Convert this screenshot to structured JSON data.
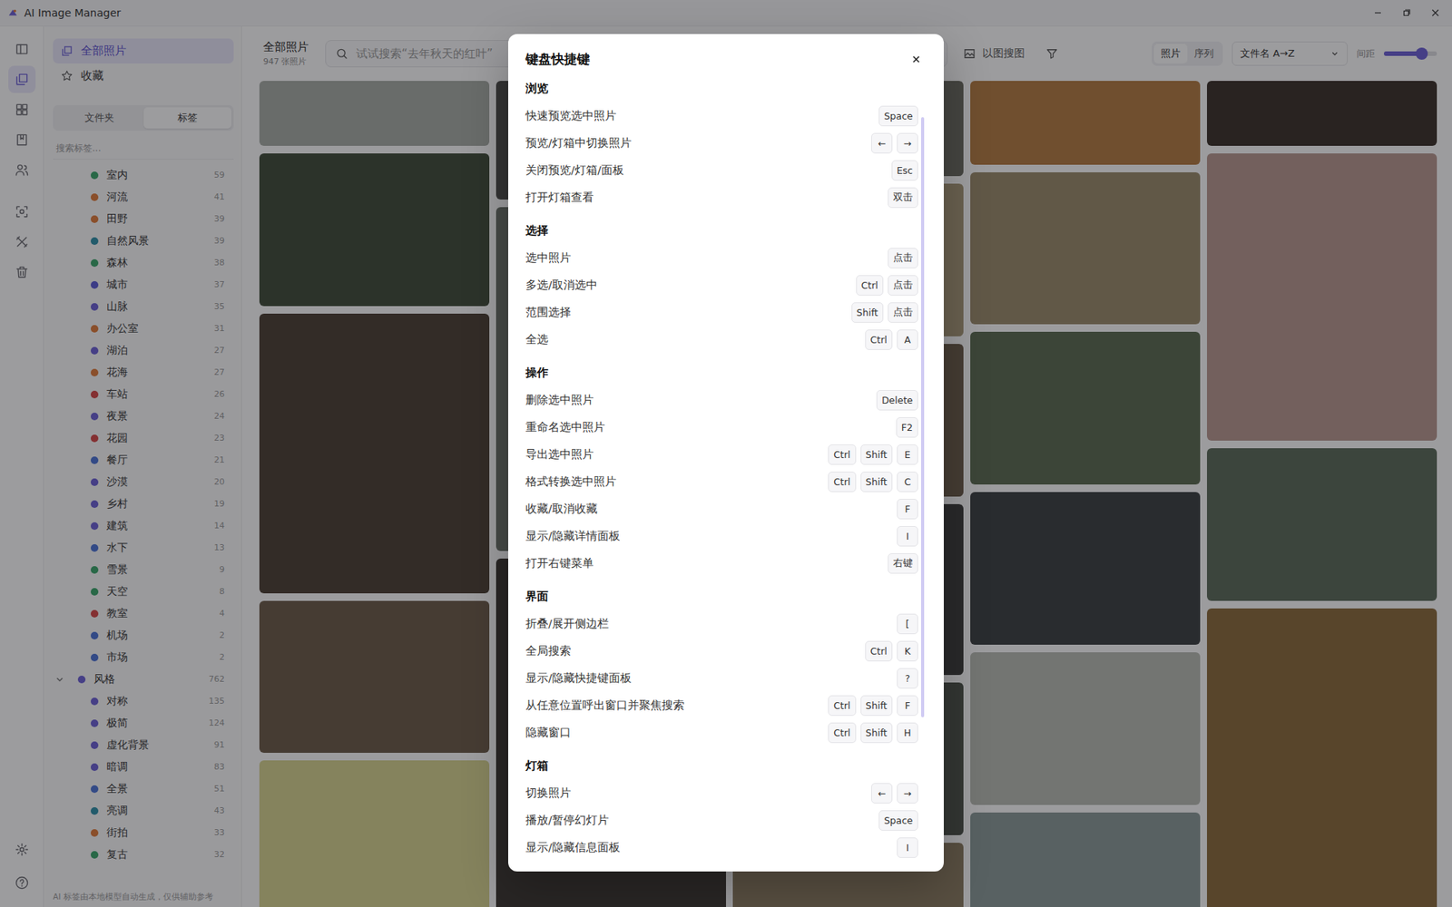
{
  "window": {
    "title": "AI Image Manager"
  },
  "rail": [
    {
      "selected": false
    },
    {
      "selected": true
    },
    {
      "selected": false
    },
    {
      "selected": false
    },
    {
      "selected": false
    },
    {
      "selected": false
    },
    {
      "selected": false
    },
    {
      "selected": false
    }
  ],
  "sidebar": {
    "nav": [
      {
        "label": "全部照片",
        "selected": true
      },
      {
        "label": "收藏",
        "selected": false
      }
    ],
    "tabs": [
      {
        "label": "文件夹",
        "selected": false
      },
      {
        "label": "标签",
        "selected": true
      }
    ],
    "search": {
      "placeholder": "搜索标签..."
    },
    "tags": [
      {
        "kind": "item",
        "name": "室内",
        "count": "59",
        "color": "#3aa66a"
      },
      {
        "kind": "item",
        "name": "河流",
        "count": "41",
        "color": "#e07b39"
      },
      {
        "kind": "item",
        "name": "田野",
        "count": "39",
        "color": "#e07b39"
      },
      {
        "kind": "item",
        "name": "自然风景",
        "count": "39",
        "color": "#2e8fa8"
      },
      {
        "kind": "item",
        "name": "森林",
        "count": "38",
        "color": "#3aa66a"
      },
      {
        "kind": "item",
        "name": "城市",
        "count": "37",
        "color": "#5b5bd6"
      },
      {
        "kind": "item",
        "name": "山脉",
        "count": "35",
        "color": "#6b5fd6"
      },
      {
        "kind": "item",
        "name": "办公室",
        "count": "31",
        "color": "#e07b39"
      },
      {
        "kind": "item",
        "name": "湖泊",
        "count": "27",
        "color": "#6b5fd6"
      },
      {
        "kind": "item",
        "name": "花海",
        "count": "27",
        "color": "#e07b39"
      },
      {
        "kind": "item",
        "name": "车站",
        "count": "26",
        "color": "#d64545"
      },
      {
        "kind": "item",
        "name": "夜景",
        "count": "24",
        "color": "#6b5fd6"
      },
      {
        "kind": "item",
        "name": "花园",
        "count": "23",
        "color": "#d64545"
      },
      {
        "kind": "item",
        "name": "餐厅",
        "count": "21",
        "color": "#4a72d6"
      },
      {
        "kind": "item",
        "name": "沙漠",
        "count": "20",
        "color": "#6b5fd6"
      },
      {
        "kind": "item",
        "name": "乡村",
        "count": "19",
        "color": "#6b5fd6"
      },
      {
        "kind": "item",
        "name": "建筑",
        "count": "14",
        "color": "#6b5fd6"
      },
      {
        "kind": "item",
        "name": "水下",
        "count": "13",
        "color": "#4a72d6"
      },
      {
        "kind": "item",
        "name": "雪景",
        "count": "9",
        "color": "#3aa66a"
      },
      {
        "kind": "item",
        "name": "天空",
        "count": "8",
        "color": "#3aa66a"
      },
      {
        "kind": "item",
        "name": "教室",
        "count": "4",
        "color": "#d64545"
      },
      {
        "kind": "item",
        "name": "机场",
        "count": "2",
        "color": "#4a72d6"
      },
      {
        "kind": "item",
        "name": "市场",
        "count": "2",
        "color": "#4a72d6"
      },
      {
        "kind": "group",
        "name": "风格",
        "count": "762",
        "color": "#6b5fd6",
        "expanded": true
      },
      {
        "kind": "item",
        "name": "对称",
        "count": "135",
        "color": "#6b5fd6"
      },
      {
        "kind": "item",
        "name": "极简",
        "count": "124",
        "color": "#6b5fd6"
      },
      {
        "kind": "item",
        "name": "虚化背景",
        "count": "91",
        "color": "#6b5fd6"
      },
      {
        "kind": "item",
        "name": "暗调",
        "count": "83",
        "color": "#6b5fd6"
      },
      {
        "kind": "item",
        "name": "全景",
        "count": "51",
        "color": "#4a72d6"
      },
      {
        "kind": "item",
        "name": "亮调",
        "count": "43",
        "color": "#2e8fa8"
      },
      {
        "kind": "item",
        "name": "街拍",
        "count": "33",
        "color": "#e07b39"
      },
      {
        "kind": "item",
        "name": "复古",
        "count": "32",
        "color": "#3aa66a"
      }
    ],
    "note": "AI 标签由本地模型自动生成，仅供辅助参考"
  },
  "main": {
    "title": "全部照片",
    "count": "947 张照片",
    "search": {
      "placeholder": "试试搜索“去年秋天的红叶”"
    },
    "image_search": "以图搜图",
    "view": [
      {
        "label": "照片",
        "selected": true
      },
      {
        "label": "序列",
        "selected": false
      }
    ],
    "sort": "文件名 A→Z",
    "spacing": {
      "label": "间距",
      "level": 0.72
    }
  },
  "photos": [
    [
      {
        "color": "#a8aca6"
      },
      {
        "color": "#3e4a38"
      },
      {
        "color": "#4a3e32"
      },
      {
        "color": "#6b5b48"
      },
      {
        "color": "#d8d490"
      }
    ],
    [
      {
        "color": "#4a4a48"
      },
      {
        "color": "#6a7068"
      },
      {
        "color": "#3a3430"
      }
    ],
    [
      {
        "color": "#6a6a60"
      },
      {
        "color": "#a89878"
      },
      {
        "color": "#6a5a48"
      },
      {
        "color": "#3a3a38"
      },
      {
        "color": "#4a5048"
      },
      {
        "color": "#8a7a60"
      }
    ],
    [
      {
        "color": "#b47a40"
      },
      {
        "color": "#9a8a6a"
      },
      {
        "color": "#5a6a50"
      },
      {
        "color": "#3a3e40"
      },
      {
        "color": "#b8bcb4"
      },
      {
        "color": "#8a9a98"
      }
    ],
    [
      {
        "color": "#3a3028"
      },
      {
        "color": "#b89890"
      },
      {
        "color": "#5a6a58"
      },
      {
        "color": "#8a6a3a"
      }
    ]
  ],
  "dialog": {
    "title": "键盘快捷键",
    "scrollbar": {
      "level": 0.82
    },
    "sections": [
      {
        "title": "浏览",
        "rows": [
          {
            "label": "快速预览选中照片",
            "keys": [
              "Space"
            ]
          },
          {
            "label": "预览/灯箱中切换照片",
            "keys": [
              "←",
              "→"
            ]
          },
          {
            "label": "关闭预览/灯箱/面板",
            "keys": [
              "Esc"
            ]
          },
          {
            "label": "打开灯箱查看",
            "keys": [
              "双击"
            ]
          }
        ]
      },
      {
        "title": "选择",
        "rows": [
          {
            "label": "选中照片",
            "keys": [
              "点击"
            ]
          },
          {
            "label": "多选/取消选中",
            "keys": [
              "Ctrl",
              "点击"
            ]
          },
          {
            "label": "范围选择",
            "keys": [
              "Shift",
              "点击"
            ]
          },
          {
            "label": "全选",
            "keys": [
              "Ctrl",
              "A"
            ]
          }
        ]
      },
      {
        "title": "操作",
        "rows": [
          {
            "label": "删除选中照片",
            "keys": [
              "Delete"
            ]
          },
          {
            "label": "重命名选中照片",
            "keys": [
              "F2"
            ]
          },
          {
            "label": "导出选中照片",
            "keys": [
              "Ctrl",
              "Shift",
              "E"
            ]
          },
          {
            "label": "格式转换选中照片",
            "keys": [
              "Ctrl",
              "Shift",
              "C"
            ]
          },
          {
            "label": "收藏/取消收藏",
            "keys": [
              "F"
            ]
          },
          {
            "label": "显示/隐藏详情面板",
            "keys": [
              "I"
            ]
          },
          {
            "label": "打开右键菜单",
            "keys": [
              "右键"
            ]
          }
        ]
      },
      {
        "title": "界面",
        "rows": [
          {
            "label": "折叠/展开侧边栏",
            "keys": [
              "["
            ]
          },
          {
            "label": "全局搜索",
            "keys": [
              "Ctrl",
              "K"
            ]
          },
          {
            "label": "显示/隐藏快捷键面板",
            "keys": [
              "?"
            ]
          },
          {
            "label": "从任意位置呼出窗口并聚焦搜索",
            "keys": [
              "Ctrl",
              "Shift",
              "F"
            ]
          },
          {
            "label": "隐藏窗口",
            "keys": [
              "Ctrl",
              "Shift",
              "H"
            ]
          }
        ]
      },
      {
        "title": "灯箱",
        "rows": [
          {
            "label": "切换照片",
            "keys": [
              "←",
              "→"
            ]
          },
          {
            "label": "播放/暂停幻灯片",
            "keys": [
              "Space"
            ]
          },
          {
            "label": "显示/隐藏信息面板",
            "keys": [
              "I"
            ]
          }
        ]
      }
    ]
  }
}
